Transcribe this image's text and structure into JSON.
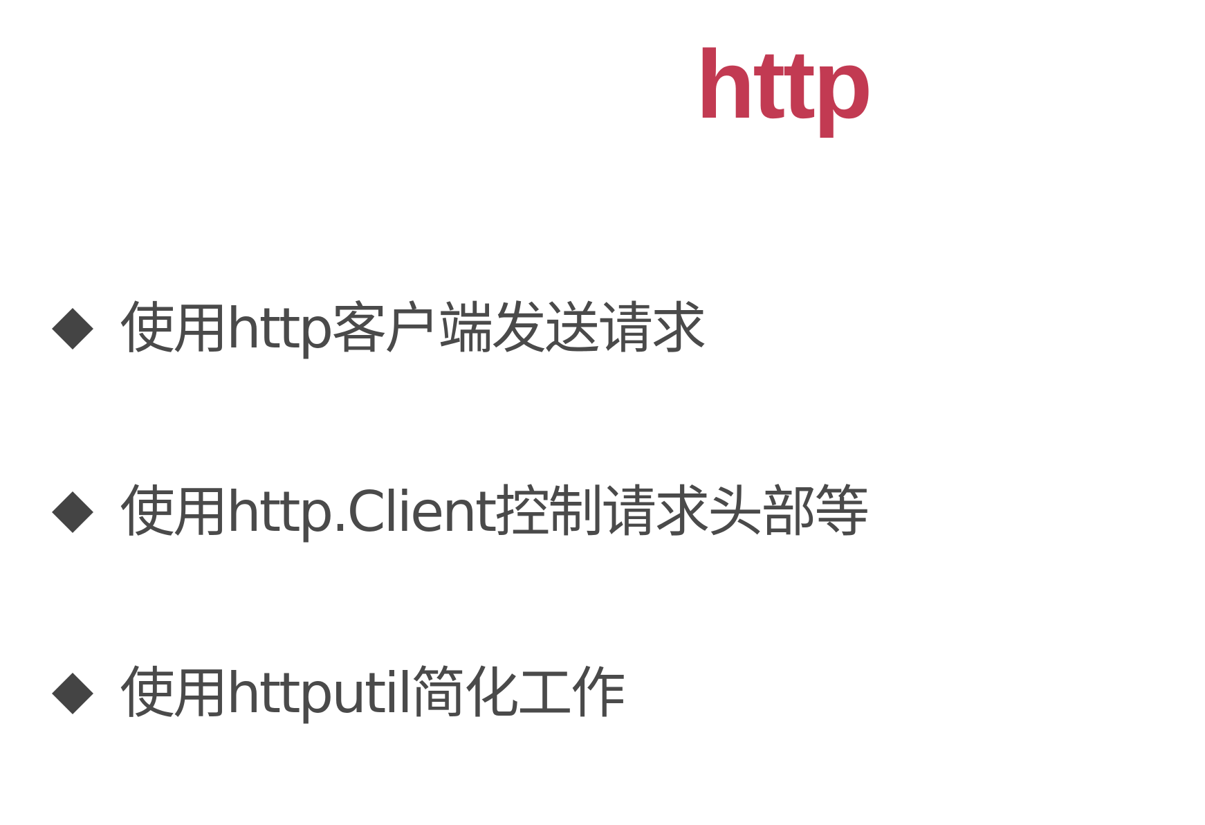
{
  "slide": {
    "title": "http",
    "bullets": [
      {
        "text": "使用http客户端发送请求"
      },
      {
        "text": "使用http.Client控制请求头部等"
      },
      {
        "text": "使用httputil简化工作"
      }
    ]
  },
  "icons": {
    "bullet_marker": "diamond-icon"
  },
  "colors": {
    "title": "#c23a52",
    "bullet_text": "#4a4a4a",
    "bullet_marker": "#444444",
    "background": "#ffffff"
  }
}
